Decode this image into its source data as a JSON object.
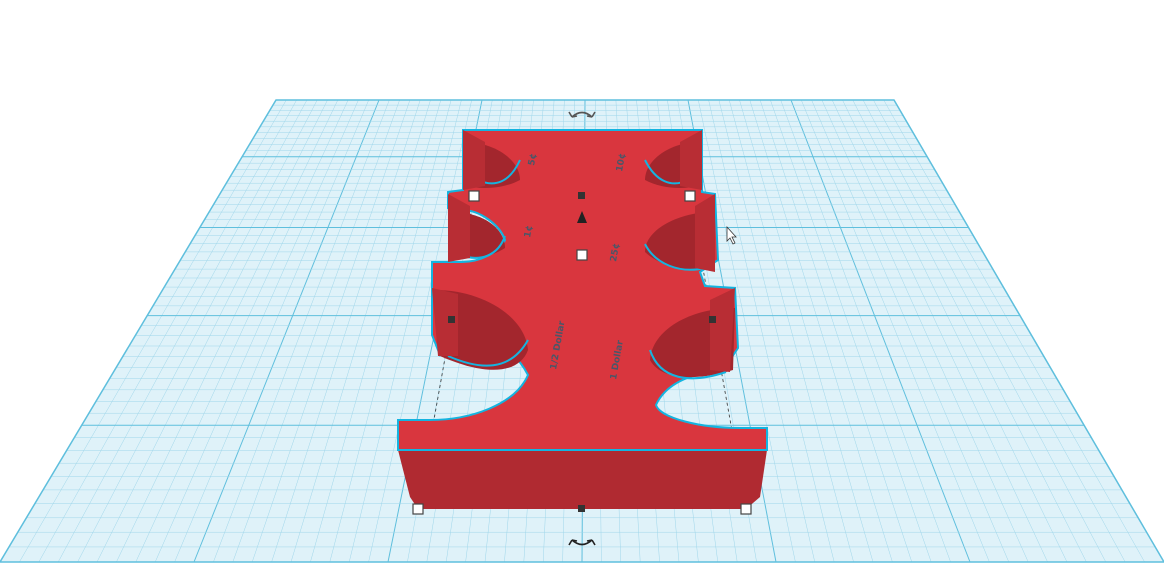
{
  "scene": {
    "workplane_color": "#dff2f9",
    "grid_minor_color": "#9fd6ea",
    "grid_major_color": "#5fbfdd",
    "object_color": "#d9363e",
    "object_shadow_color": "#b02a31",
    "selection_outline_color": "#14b4e0",
    "handle_fill": "#ffffff",
    "handle_stroke": "#444444"
  },
  "engravings": {
    "left_top": "5¢",
    "right_top": "10¢",
    "left_mid": "1¢",
    "right_mid": "25¢",
    "left_bottom": "1 Dollar",
    "right_bottom": "1/2 Dollar"
  },
  "icons": {
    "rotate_top": "rotate-arrow-icon",
    "rotate_bottom": "rotate-arrow-icon",
    "lift_cone": "lift-cone-icon",
    "cursor": "mouse-cursor-icon"
  }
}
